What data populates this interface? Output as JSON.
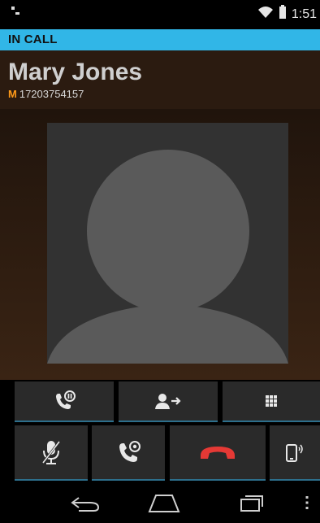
{
  "status_bar": {
    "left_icon": "voicemail-icon",
    "time": "1:51",
    "icons": [
      "wifi-icon",
      "battery-icon"
    ]
  },
  "call": {
    "status_label": "IN CALL",
    "caller_name": "Mary Jones",
    "number_type": "M",
    "number": "17203754157"
  },
  "buttons": {
    "hold": "hold-call-icon",
    "transfer": "transfer-call-icon",
    "keypad": "dialpad-icon",
    "mute": "mute-icon",
    "add_call": "add-call-icon",
    "end_call": "end-call-icon",
    "speaker": "speaker-icon"
  },
  "colors": {
    "accent": "#31b6e7",
    "end_call": "#e53935",
    "number_type": "#ff9a19"
  }
}
